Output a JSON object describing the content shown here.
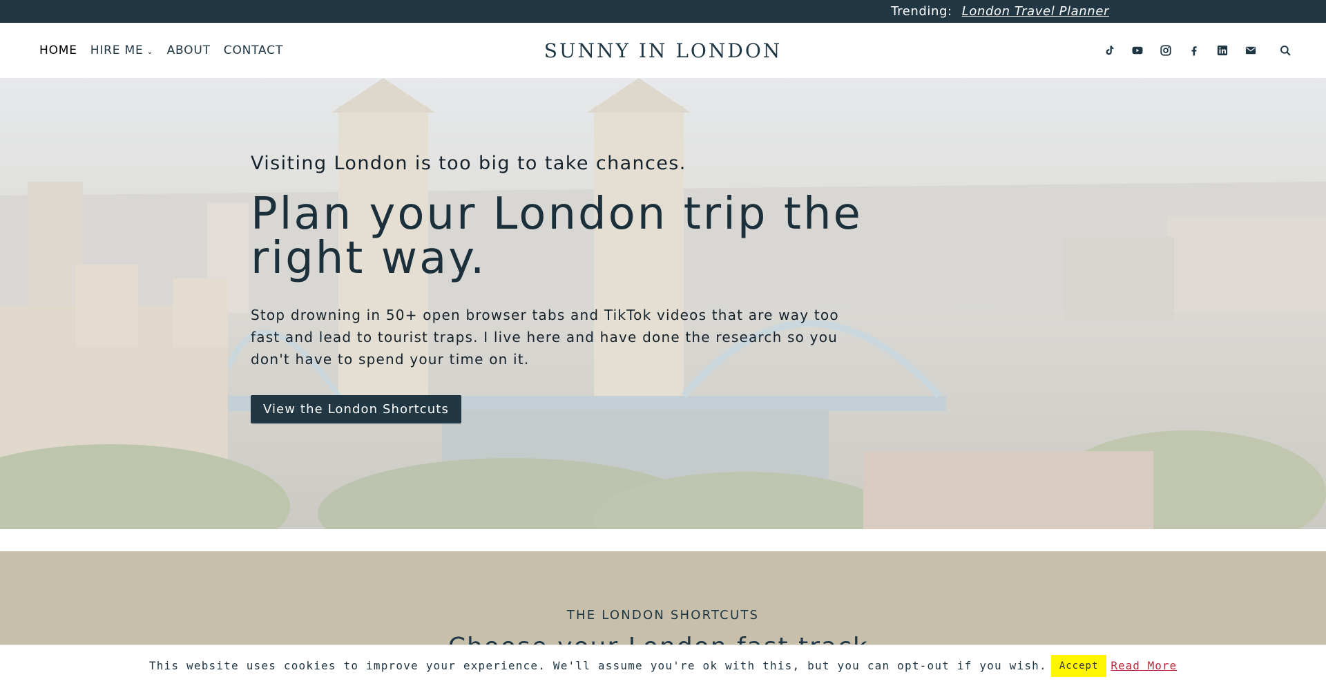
{
  "topbar": {
    "trending_label": "Trending:",
    "trending_link": "London Travel Planner"
  },
  "header": {
    "nav": [
      {
        "label": "HOME"
      },
      {
        "label": "HIRE ME"
      },
      {
        "label": "ABOUT"
      },
      {
        "label": "CONTACT"
      }
    ],
    "brand": "SUNNY IN LONDON",
    "socials": [
      "tiktok-icon",
      "youtube-icon",
      "instagram-icon",
      "facebook-icon",
      "linkedin-icon",
      "email-icon"
    ],
    "search_icon": "search-icon"
  },
  "hero": {
    "kicker": "Visiting London is too big to take chances.",
    "title": "Plan your London trip the right way.",
    "text": "Stop drowning in 50+ open browser tabs and TikTok videos that are way too fast and lead to tourist traps. I live here and have done the research so you don't have to spend your time on it.",
    "button": "View the London Shortcuts"
  },
  "shortcuts": {
    "eyebrow": "THE LONDON SHORTCUTS",
    "heading": "Choose your London fast track."
  },
  "cookie": {
    "message": "This website uses cookies to improve your experience. We'll assume you're ok with this, but you can opt-out if you wish.",
    "accept": "Accept",
    "read_more": "Read More"
  },
  "colors": {
    "navy": "#213743",
    "tan": "#c7bfa9",
    "accept_yellow": "#fff500",
    "link_red": "#c0243a"
  }
}
